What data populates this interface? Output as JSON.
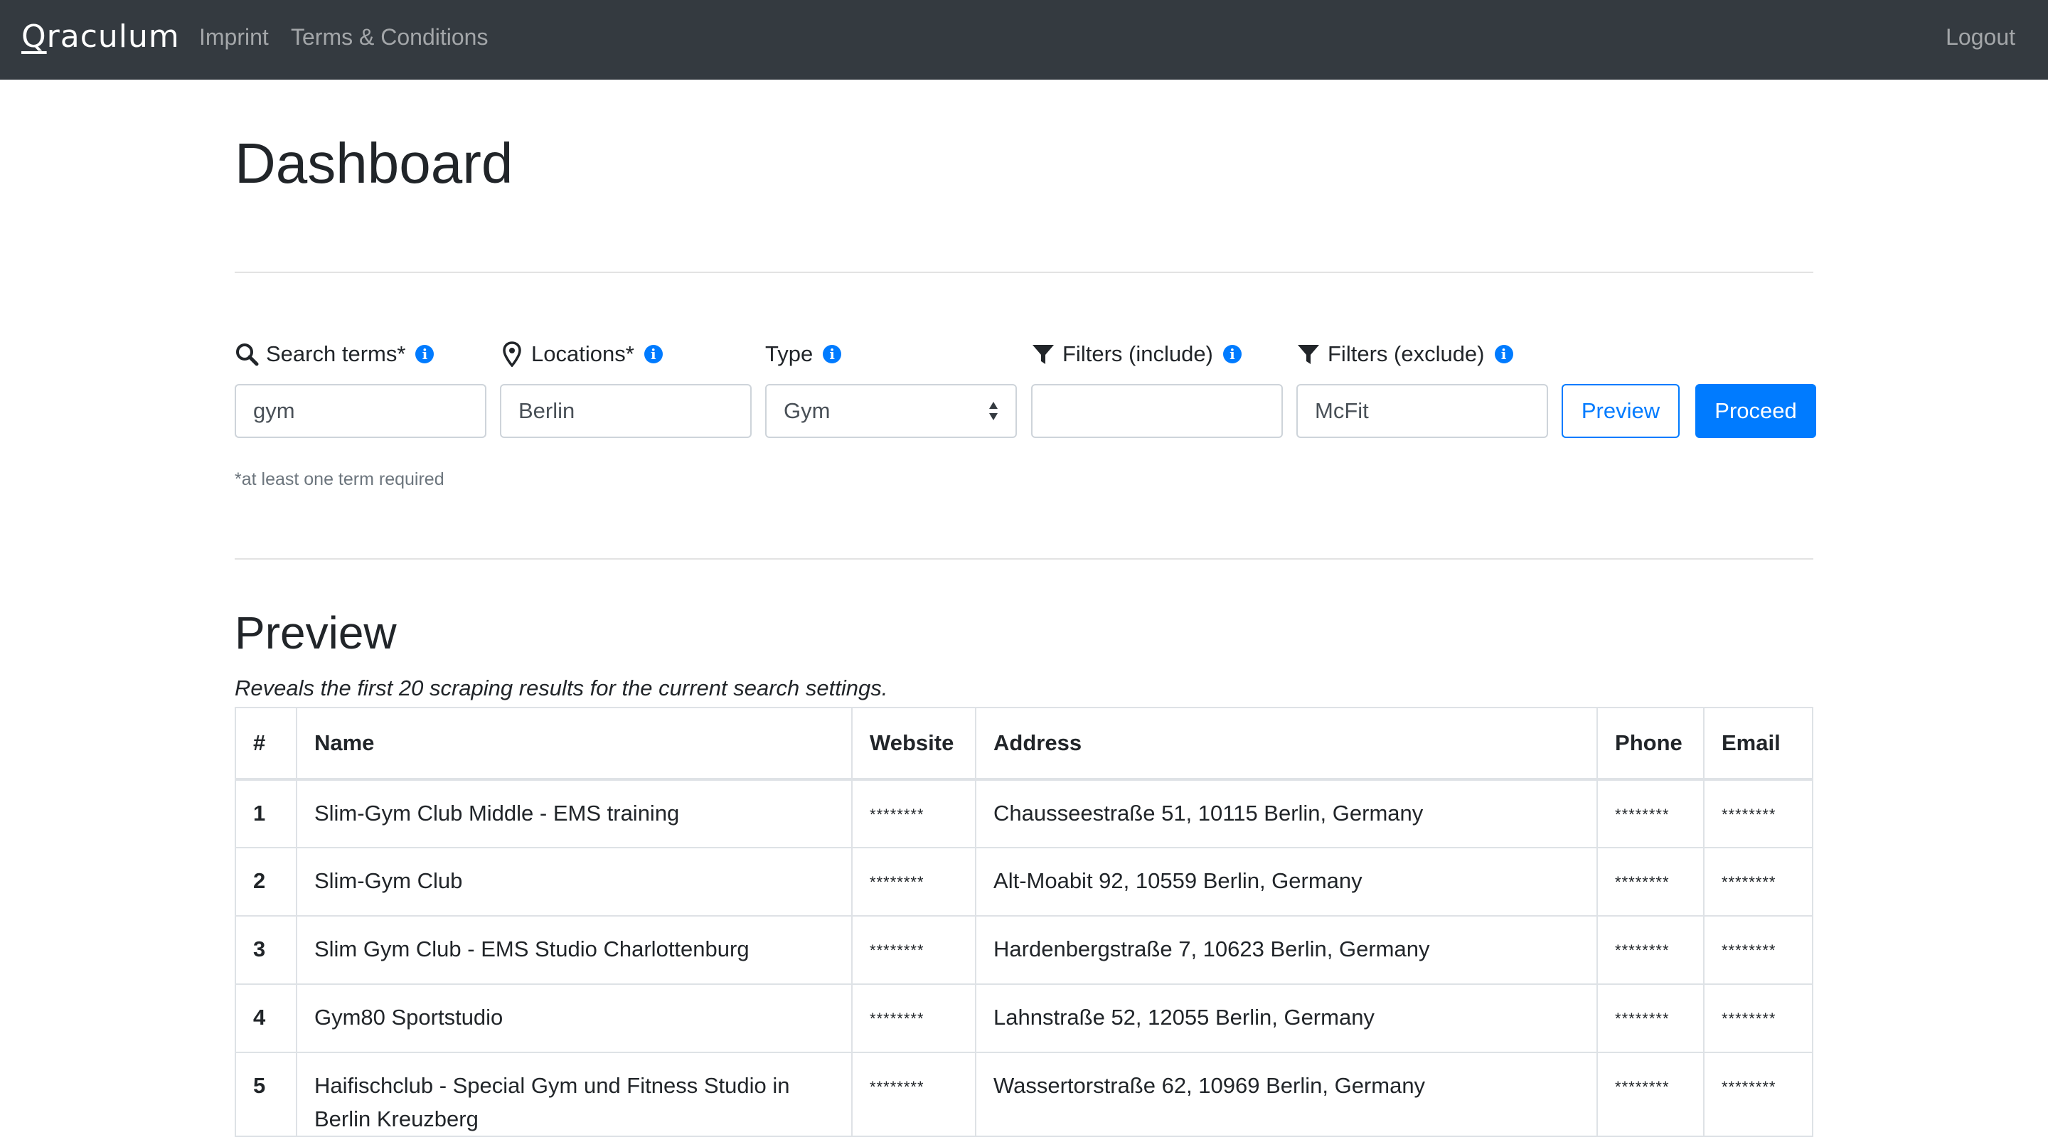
{
  "navbar": {
    "brand_first": "Q",
    "brand_rest": "raculum",
    "links": {
      "imprint": "Imprint",
      "terms": "Terms & Conditions",
      "logout": "Logout"
    }
  },
  "page_title": "Dashboard",
  "form": {
    "search_terms": {
      "label": "Search terms*",
      "value": "gym"
    },
    "locations": {
      "label": "Locations*",
      "value": "Berlin"
    },
    "type": {
      "label": "Type",
      "value": "Gym"
    },
    "filters_include": {
      "label": "Filters (include)",
      "value": ""
    },
    "filters_exclude": {
      "label": "Filters (exclude)",
      "value": "McFit"
    },
    "preview_label": "Preview",
    "proceed_label": "Proceed",
    "hint": "*at least one term required",
    "info_glyph": "i"
  },
  "preview": {
    "heading": "Preview",
    "subtitle": "Reveals the first 20 scraping results for the current search settings.",
    "columns": [
      "#",
      "Name",
      "Website",
      "Address",
      "Phone",
      "Email"
    ],
    "rows": [
      {
        "num": "1",
        "name": "Slim-Gym Club Middle - EMS training",
        "website": "********",
        "address": "Chausseestraße 51, 10115 Berlin, Germany",
        "phone": "********",
        "email": "********"
      },
      {
        "num": "2",
        "name": "Slim-Gym Club",
        "website": "********",
        "address": "Alt-Moabit 92, 10559 Berlin, Germany",
        "phone": "********",
        "email": "********"
      },
      {
        "num": "3",
        "name": "Slim Gym Club - EMS Studio Charlottenburg",
        "website": "********",
        "address": "Hardenbergstraße 7, 10623 Berlin, Germany",
        "phone": "********",
        "email": "********"
      },
      {
        "num": "4",
        "name": "Gym80 Sportstudio",
        "website": "********",
        "address": "Lahnstraße 52, 12055 Berlin, Germany",
        "phone": "********",
        "email": "********"
      },
      {
        "num": "5",
        "name": "Haifischclub - Special Gym und Fitness Studio in Berlin Kreuzberg",
        "website": "********",
        "address": "Wassertorstraße 62, 10969 Berlin, Germany",
        "phone": "********",
        "email": "********"
      }
    ]
  },
  "colors": {
    "navbar": "#343a40",
    "primary": "#007bff",
    "muted": "#6c757d"
  },
  "icons": [
    "search-icon",
    "map-marker-icon",
    "filter-icon",
    "info-icon"
  ]
}
